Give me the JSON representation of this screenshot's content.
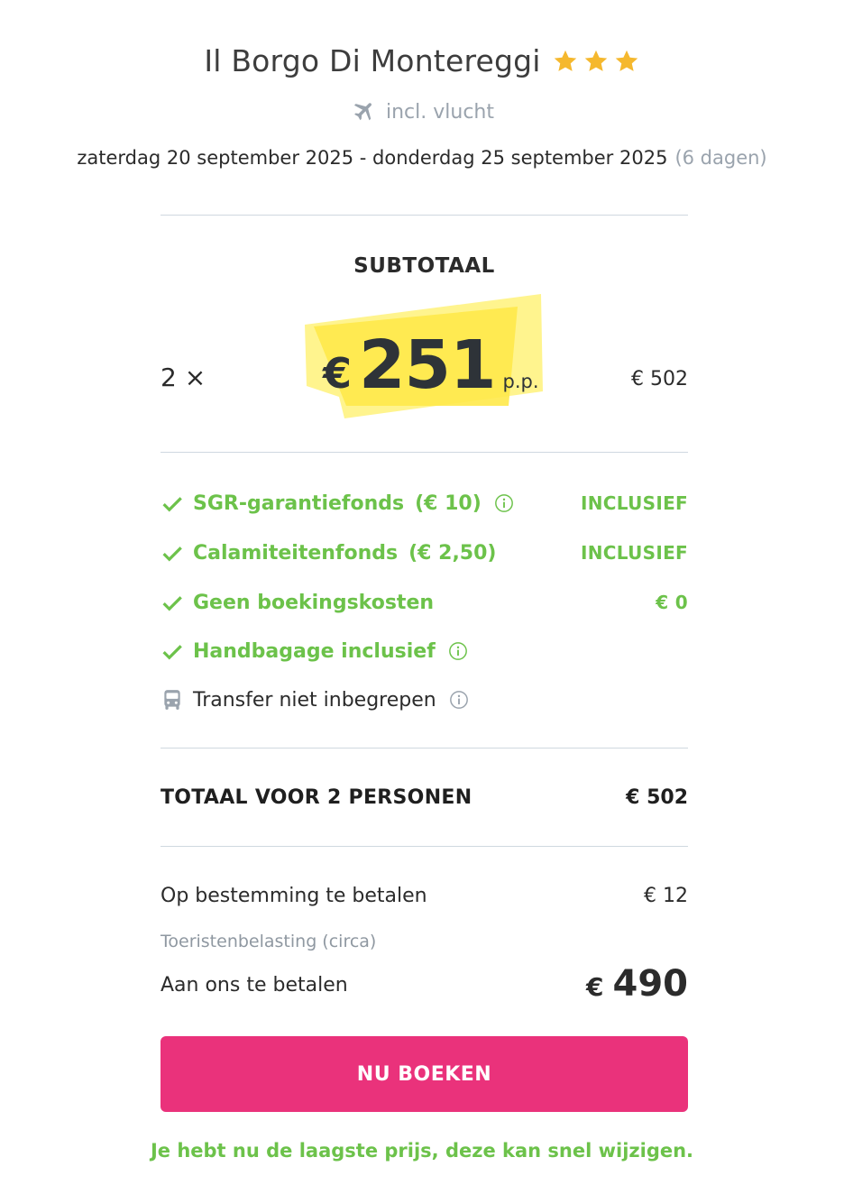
{
  "header": {
    "hotel_name": "Il Borgo Di Montereggi",
    "stars": 3,
    "flight_label": "incl. vlucht",
    "date_range": "zaterdag 20 september 2025 - donderdag 25 september 2025",
    "duration": "(6 dagen)"
  },
  "subtotal": {
    "label": "SUBTOTAAL",
    "quantity": "2 ×",
    "currency": "€",
    "price_per_person": "251",
    "per_person_label": "p.p.",
    "line_total": "€ 502"
  },
  "features": [
    {
      "label": "SGR-garantiefonds",
      "price": "(€ 10)",
      "value": "INCLUSIEF",
      "icon": "check-icon",
      "info": true
    },
    {
      "label": "Calamiteitenfonds",
      "price": "(€ 2,50)",
      "value": "INCLUSIEF",
      "icon": "check-icon",
      "info": false
    },
    {
      "label": "Geen boekingskosten",
      "price": "",
      "value": "€ 0",
      "icon": "check-icon",
      "info": false
    },
    {
      "label": "Handbagage inclusief",
      "price": "",
      "value": "",
      "icon": "check-icon",
      "info": true
    },
    {
      "label": "Transfer niet inbegrepen",
      "price": "",
      "value": "",
      "icon": "bus-icon",
      "info": true
    }
  ],
  "total": {
    "label": "TOTAAL VOOR 2 PERSONEN",
    "value": "€ 502"
  },
  "payment": {
    "destination_label": "Op bestemming te betalen",
    "destination_value": "€ 12",
    "destination_note": "Toeristenbelasting (circa)",
    "pay_us_label": "Aan ons te betalen",
    "pay_us_currency": "€",
    "pay_us_value": "490"
  },
  "actions": {
    "book_label": "NU BOEKEN"
  },
  "footnote": "Je hebt nu de laagste prijs, deze kan snel wijzigen.",
  "colors": {
    "green": "#6cc24a",
    "pink": "#ea327b",
    "star": "#f5b82e",
    "highlight": "#fff15c"
  }
}
